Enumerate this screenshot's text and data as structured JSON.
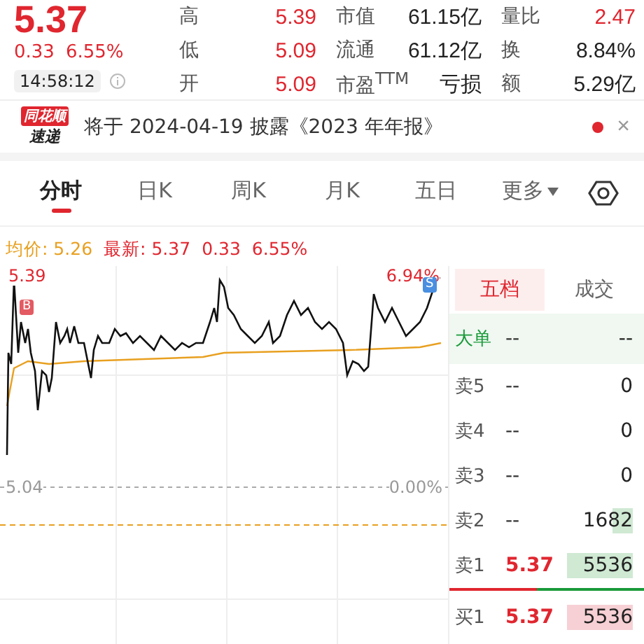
{
  "quote": {
    "price": "5.37",
    "change": "0.33",
    "percent": "6.55%",
    "time": "14:58:12"
  },
  "stats": [
    {
      "label": "高",
      "value": "5.39",
      "kind": "price"
    },
    {
      "label": "市值",
      "value": "61.15亿",
      "kind": "plain"
    },
    {
      "label": "量比",
      "value": "2.47",
      "kind": "price"
    },
    {
      "label": "低",
      "value": "5.09",
      "kind": "price"
    },
    {
      "label": "流通",
      "value": "61.12亿",
      "kind": "plain"
    },
    {
      "label": "换",
      "value": "8.84%",
      "kind": "plain"
    },
    {
      "label": "开",
      "value": "5.09",
      "kind": "price"
    },
    {
      "label": "市盈$^{TTM}$",
      "value": "亏损",
      "kind": "plain"
    },
    {
      "label": "额",
      "value": "5.29亿",
      "kind": "plain"
    }
  ],
  "notice": {
    "logo_top": "同花顺",
    "logo_bottom": "速递",
    "text": "将于 2024-04-19 披露《2023 年年报》",
    "close": "×"
  },
  "tabs": [
    {
      "label": "分时",
      "selected": true
    },
    {
      "label": "日K",
      "selected": false
    },
    {
      "label": "周K",
      "selected": false
    },
    {
      "label": "月K",
      "selected": false
    },
    {
      "label": "五日",
      "selected": false
    },
    {
      "label": "更多",
      "selected": false
    }
  ],
  "chart_header": {
    "avg_label": "均价: 5.26",
    "latest_label": "最新: 5.37",
    "change": "0.33",
    "percent": "6.55%"
  },
  "chart": {
    "top_price": "5.39",
    "top_percent": "6.94%",
    "base_price": "5.04",
    "base_percent": "0.00%",
    "buy_marker": "B",
    "sell_marker": "S"
  },
  "book_tabs": [
    {
      "label": "五档",
      "selected": true
    },
    {
      "label": "成交",
      "selected": false
    }
  ],
  "book": [
    {
      "kind": "big",
      "label": "大单",
      "price": "--",
      "volume": "--"
    },
    {
      "kind": "sell",
      "label": "卖5",
      "price": "--",
      "volume": "0"
    },
    {
      "kind": "sell",
      "label": "卖4",
      "price": "--",
      "volume": "0"
    },
    {
      "kind": "sell",
      "label": "卖3",
      "price": "--",
      "volume": "0"
    },
    {
      "kind": "sell",
      "label": "卖2",
      "price": "--",
      "volume": "1682"
    },
    {
      "kind": "sell",
      "label": "卖1",
      "price": "5.37",
      "volume": "5536"
    },
    {
      "kind": "buy",
      "label": "买1",
      "price": "5.37",
      "volume": "5536"
    }
  ]
}
